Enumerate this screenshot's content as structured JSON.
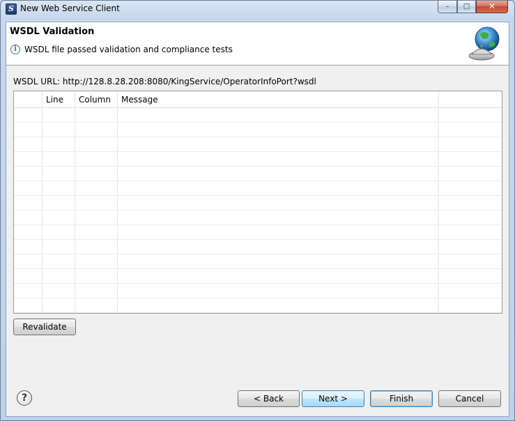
{
  "window": {
    "title": "New Web Service Client",
    "icon": "eclipse-s-icon",
    "controls": {
      "minimize": "–",
      "maximize": "□",
      "close": "✕"
    }
  },
  "banner": {
    "title": "WSDL Validation",
    "message": "WSDL file passed validation and compliance tests",
    "info_icon": "i",
    "graphic": "globe-service-icon"
  },
  "wsdl_url": "WSDL URL: http://128.8.28.208:8080/KingService/OperatorInfoPort?wsdl",
  "table": {
    "columns": [
      "",
      "Line",
      "Column",
      "Message",
      ""
    ],
    "rows": []
  },
  "buttons": {
    "revalidate": "Revalidate",
    "back": "< Back",
    "next": "Next >",
    "finish": "Finish",
    "cancel": "Cancel",
    "help": "?"
  },
  "colors": {
    "accent": "#3c7fb1",
    "info": "#3a6ea5",
    "close": "#c44a2f"
  }
}
